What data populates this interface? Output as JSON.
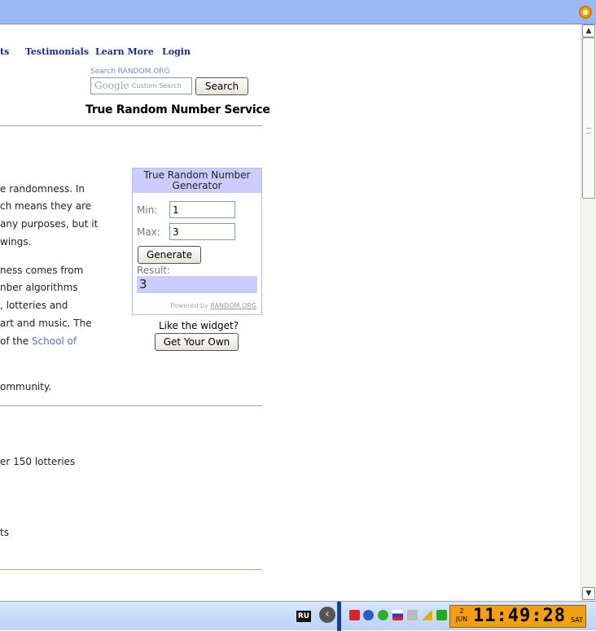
{
  "nav": [
    "ts",
    "Testimonials",
    "Learn More",
    "Login"
  ],
  "search": {
    "label": "Search RANDOM.ORG",
    "google": "Google",
    "placeholder": "Custom Search",
    "button": "Search"
  },
  "service_title": "True Random Number Service",
  "paragraphs": [
    "e randomness. In",
    "ch means they are",
    "any purposes, but it",
    "wings.",
    "ness comes from",
    "nber algorithms",
    ", lotteries and",
    "art and music. The",
    "of the",
    "ommunity.",
    "er 150 lotteries",
    "ts"
  ],
  "link_text": "School of",
  "widget": {
    "title": "True Random Number Generator",
    "min_label": "Min:",
    "min_value": "1",
    "max_label": "Max:",
    "max_value": "3",
    "generate": "Generate",
    "result_label": "Result:",
    "result": "3",
    "powered_by": "Powered by",
    "powered_link": "RANDOM.ORG"
  },
  "like": "Like the widget?",
  "get_own": "Get Your Own",
  "taskbar": {
    "lang": "RU",
    "date_day": "2",
    "date_month": "JUN",
    "time": "11:49:28",
    "weekday": "SAT",
    "colors": {
      "clock": "#f0a010",
      "taskbar": "#bcd2f5"
    }
  }
}
